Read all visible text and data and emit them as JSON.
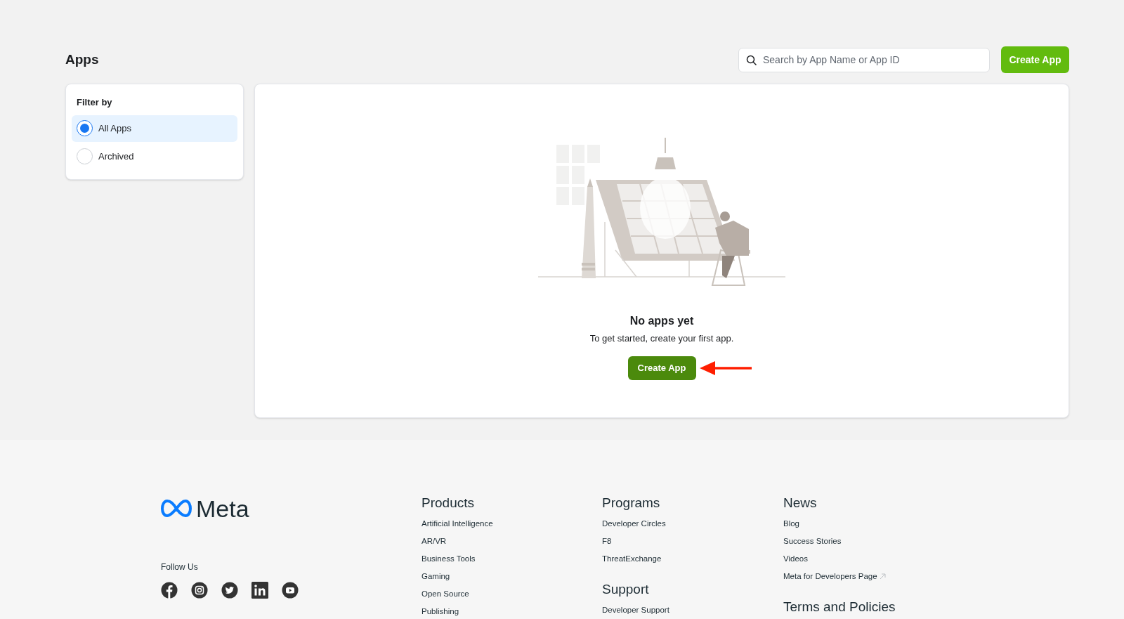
{
  "header": {
    "title": "Apps",
    "search": {
      "placeholder": "Search by App Name or App ID"
    },
    "create_button": "Create App"
  },
  "filter": {
    "title": "Filter by",
    "options": [
      {
        "label": "All Apps",
        "selected": true
      },
      {
        "label": "Archived",
        "selected": false
      }
    ]
  },
  "empty_state": {
    "title": "No apps yet",
    "message": "To get started, create your first app.",
    "button": "Create App"
  },
  "footer": {
    "logo_text": "Meta",
    "follow_label": "Follow Us",
    "social": [
      {
        "kind": "facebook"
      },
      {
        "kind": "instagram"
      },
      {
        "kind": "twitter"
      },
      {
        "kind": "linkedin"
      },
      {
        "kind": "youtube"
      }
    ],
    "columns": [
      {
        "sections": [
          {
            "heading": "Products",
            "links": [
              {
                "label": "Artificial Intelligence"
              },
              {
                "label": "AR/VR"
              },
              {
                "label": "Business Tools"
              },
              {
                "label": "Gaming"
              },
              {
                "label": "Open Source"
              },
              {
                "label": "Publishing"
              }
            ]
          }
        ]
      },
      {
        "sections": [
          {
            "heading": "Programs",
            "links": [
              {
                "label": "Developer Circles"
              },
              {
                "label": "F8"
              },
              {
                "label": "ThreatExchange"
              }
            ]
          },
          {
            "heading": "Support",
            "links": [
              {
                "label": "Developer Support"
              }
            ]
          }
        ]
      },
      {
        "sections": [
          {
            "heading": "News",
            "links": [
              {
                "label": "Blog"
              },
              {
                "label": "Success Stories"
              },
              {
                "label": "Videos"
              },
              {
                "label": "Meta for Developers Page",
                "external": true
              }
            ]
          },
          {
            "heading": "Terms and Policies"
          }
        ]
      }
    ]
  }
}
